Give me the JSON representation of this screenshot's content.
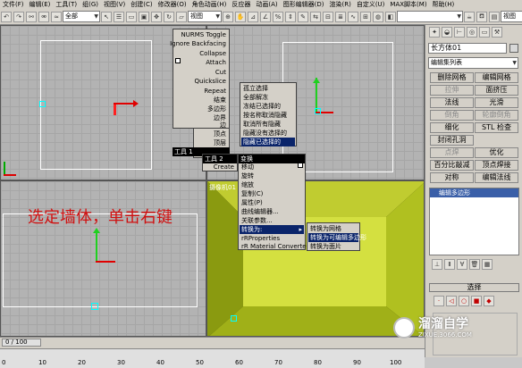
{
  "menubar": [
    "文件(F)",
    "编辑(E)",
    "工具(T)",
    "组(G)",
    "视图(V)",
    "创建(C)",
    "修改器(O)",
    "角色动画(H)",
    "反应器",
    "动画(A)",
    "图形编辑器(D)",
    "渲染(R)",
    "自定义(U)",
    "MAX脚本(M)",
    "帮助(H)"
  ],
  "toolbar": {
    "filter": "全部",
    "coord": "视图",
    "coord2": "视图"
  },
  "viewports": {
    "bottom_left": {
      "slider_text": "0 / 100"
    },
    "bottom_right": {
      "label": "摄像机01"
    }
  },
  "overlay_text": "选定墙体，单击右键",
  "quad_left": {
    "upper": {
      "header": "",
      "items": [
        "NURMS Toggle",
        "Ignore Backfacing",
        "Collapse",
        "Attach",
        "Cut",
        "Quickslice",
        "Repeat",
        "结束",
        "多边形",
        "边界",
        "边",
        "顶点",
        "顶层"
      ]
    },
    "footer": "工具 1"
  },
  "quad_right": {
    "items": [
      "孤立选择",
      "全部解冻",
      "冻结已选择的",
      "按名称取消隐藏",
      "取消所有隐藏",
      "隐藏没有选择的",
      "隐藏已选择的"
    ]
  },
  "quad_lower_left": {
    "header": "工具 2",
    "items": [
      "Create"
    ]
  },
  "quad_lower_right": {
    "header": "变换",
    "items": [
      "移动",
      "旋转",
      "缩放",
      "复制(C)",
      "属性(P)",
      "曲线编辑器...",
      "关联参数...",
      "转换为:",
      "rRProperties",
      "rR Material Converter"
    ]
  },
  "submenu": {
    "items": [
      "转换为网格",
      "转换为可编辑多边形",
      "转换为面片"
    ]
  },
  "cmdpanel": {
    "object_name": "长方体01",
    "modifier_list": "编辑集列表",
    "buttons": [
      [
        "删除网格",
        "编辑网格"
      ],
      [
        "拉伸",
        "面挤压"
      ],
      [
        "法线",
        "光滑"
      ],
      [
        "倒角",
        "轮廓倒角"
      ],
      [
        "细化",
        "STL 检查"
      ],
      [
        "封闭孔洞",
        ""
      ],
      [
        "点焊",
        "优化"
      ],
      [
        "百分比敲减",
        "顶点焊接"
      ],
      [
        "对称",
        "编辑法线"
      ]
    ],
    "stack_item": "编辑多边形",
    "select_title": "选择"
  },
  "status": {
    "frame": "0 / 100",
    "ruler": [
      "0",
      "10",
      "20",
      "30",
      "40",
      "50",
      "60",
      "70",
      "80",
      "90",
      "100"
    ],
    "watermark_title": "溜溜自学",
    "watermark_url": "ZIXUE.3066.COM"
  }
}
